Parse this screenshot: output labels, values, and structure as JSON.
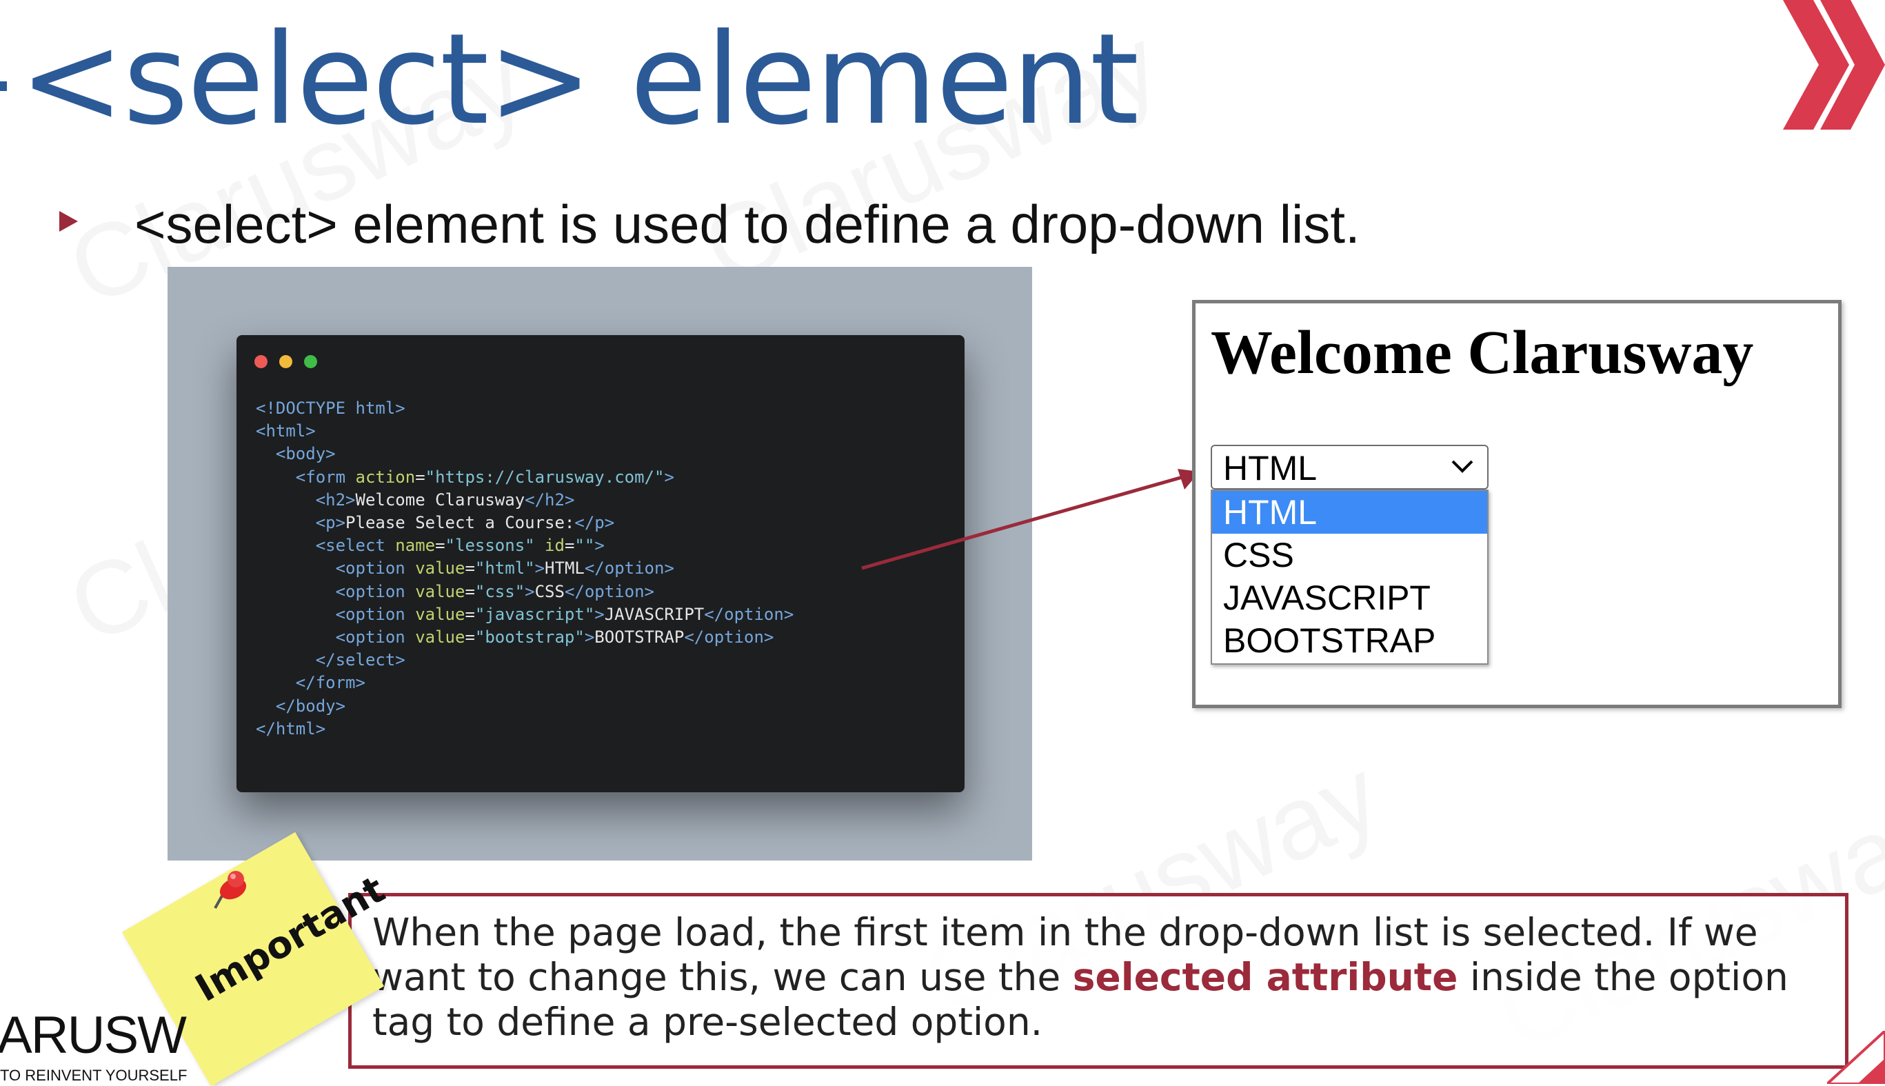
{
  "slide": {
    "title": "<select> element",
    "bullet": "<select> element is used to define a drop-down list."
  },
  "code": {
    "lines": [
      [
        [
          "tg",
          "<!DOCTYPE html>"
        ]
      ],
      [
        [
          "tg",
          "<html>"
        ]
      ],
      [
        [
          "tg",
          "  <body>"
        ]
      ],
      [
        [
          "tg",
          "    <form "
        ],
        [
          "at",
          "action"
        ],
        [
          "tx",
          "="
        ],
        [
          "st",
          "\"https://clarusway.com/\""
        ],
        [
          "tg",
          ">"
        ]
      ],
      [
        [
          "tg",
          "      <h2>"
        ],
        [
          "tx",
          "Welcome Clarusway"
        ],
        [
          "tg",
          "</h2>"
        ]
      ],
      [
        [
          "tg",
          "      <p>"
        ],
        [
          "tx",
          "Please Select a Course:"
        ],
        [
          "tg",
          "</p>"
        ]
      ],
      [
        [
          "tg",
          "      <select "
        ],
        [
          "at",
          "name"
        ],
        [
          "tx",
          "="
        ],
        [
          "st",
          "\"lessons\""
        ],
        [
          "tx",
          " "
        ],
        [
          "at",
          "id"
        ],
        [
          "tx",
          "="
        ],
        [
          "st",
          "\"\""
        ],
        [
          "tg",
          ">"
        ]
      ],
      [
        [
          "tg",
          "        <option "
        ],
        [
          "at",
          "value"
        ],
        [
          "tx",
          "="
        ],
        [
          "st",
          "\"html\""
        ],
        [
          "tg",
          ">"
        ],
        [
          "tx",
          "HTML"
        ],
        [
          "tg",
          "</option>"
        ]
      ],
      [
        [
          "tg",
          "        <option "
        ],
        [
          "at",
          "value"
        ],
        [
          "tx",
          "="
        ],
        [
          "st",
          "\"css\""
        ],
        [
          "tg",
          ">"
        ],
        [
          "tx",
          "CSS"
        ],
        [
          "tg",
          "</option>"
        ]
      ],
      [
        [
          "tg",
          "        <option "
        ],
        [
          "at",
          "value"
        ],
        [
          "tx",
          "="
        ],
        [
          "st",
          "\"javascript\""
        ],
        [
          "tg",
          ">"
        ],
        [
          "tx",
          "JAVASCRIPT"
        ],
        [
          "tg",
          "</option>"
        ]
      ],
      [
        [
          "tg",
          "        <option "
        ],
        [
          "at",
          "value"
        ],
        [
          "tx",
          "="
        ],
        [
          "st",
          "\"bootstrap\""
        ],
        [
          "tg",
          ">"
        ],
        [
          "tx",
          "BOOTSTRAP"
        ],
        [
          "tg",
          "</option>"
        ]
      ],
      [
        [
          "tg",
          "      </select>"
        ]
      ],
      [
        [
          "tg",
          "    </form>"
        ]
      ],
      [
        [
          "tg",
          "  </body>"
        ]
      ],
      [
        [
          "tg",
          "</html>"
        ]
      ]
    ]
  },
  "demo": {
    "heading": "Welcome Clarusway",
    "select_value": "HTML",
    "options": [
      "HTML",
      "CSS",
      "JAVASCRIPT",
      "BOOTSTRAP"
    ],
    "highlighted_option": "HTML"
  },
  "note": {
    "sticky_label": "Important",
    "callout_before": "When the page load, the first item in the drop-down list is selected. If we want to change this, we can use the ",
    "callout_strong": "selected attribute",
    "callout_after": " inside the option tag to define a pre-selected option."
  },
  "brand": {
    "name": "ARUSW",
    "tagline": "TO REINVENT YOURSELF",
    "watermark": "Clarusway"
  },
  "colors": {
    "title": "#2b5a97",
    "accent": "#9b2a3b",
    "logo_red": "#d93a4e",
    "selected_option": "#3d8bf6",
    "sticky": "#f7f37f"
  },
  "icons": {
    "window_dots": [
      "#ee5b57",
      "#f2bb3a",
      "#3fbd48"
    ],
    "logo": "double-chevron-icon",
    "dropdown": "chevron-down-icon",
    "pin": "pushpin-icon"
  }
}
